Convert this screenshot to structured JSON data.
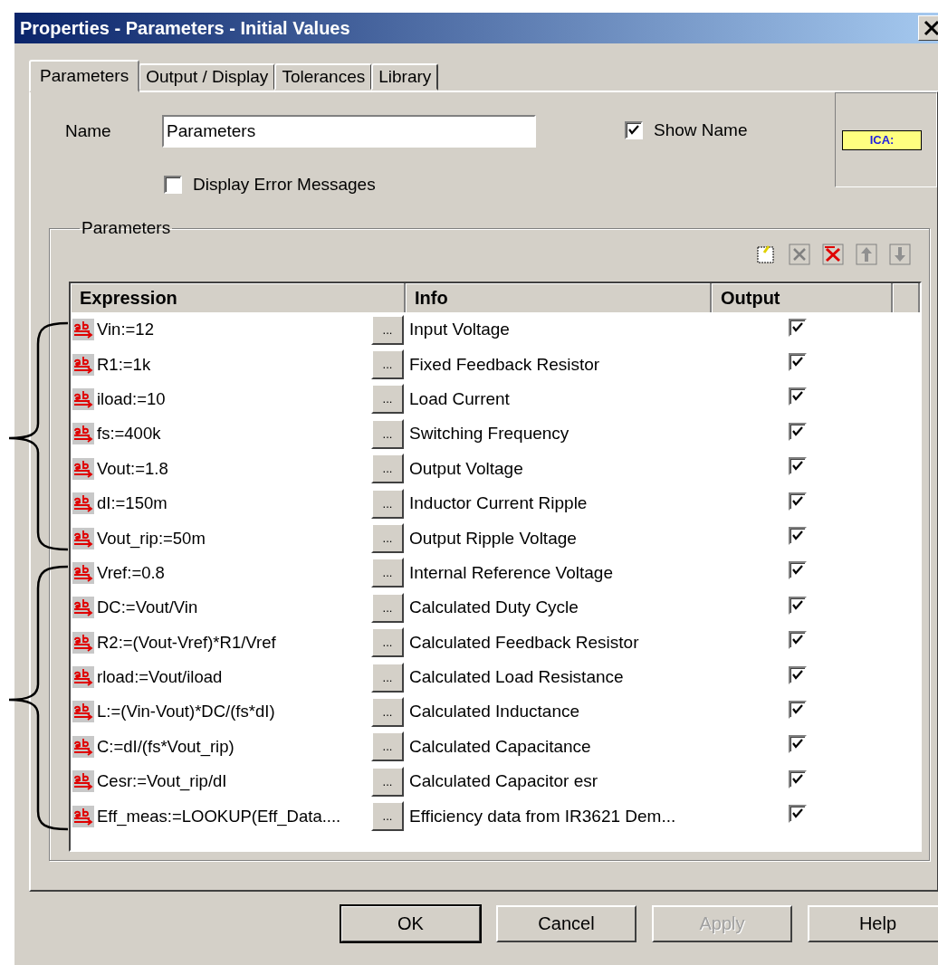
{
  "window": {
    "title": "Properties - Parameters - Initial Values"
  },
  "tabs": [
    {
      "label": "Parameters",
      "selected": true
    },
    {
      "label": "Output / Display",
      "selected": false
    },
    {
      "label": "Tolerances",
      "selected": false
    },
    {
      "label": "Library",
      "selected": false
    }
  ],
  "name_field": {
    "label": "Name",
    "value": "Parameters"
  },
  "show_name": {
    "label": "Show Name",
    "checked": true
  },
  "display_errors": {
    "label": "Display Error Messages",
    "checked": false
  },
  "preview": {
    "label": "ICA:"
  },
  "group": {
    "title": "Parameters"
  },
  "table": {
    "columns": [
      "Expression",
      "Info",
      "Output"
    ],
    "rows": [
      {
        "expression": "Vin:=12",
        "button": "...",
        "info": "Input Voltage",
        "output": true
      },
      {
        "expression": "R1:=1k",
        "button": "...",
        "info": "Fixed Feedback Resistor",
        "output": true
      },
      {
        "expression": "iload:=10",
        "button": "...",
        "info": "Load Current",
        "output": true
      },
      {
        "expression": "fs:=400k",
        "button": "...",
        "info": "Switching Frequency",
        "output": true
      },
      {
        "expression": "Vout:=1.8",
        "button": "...",
        "info": "Output Voltage",
        "output": true
      },
      {
        "expression": "dI:=150m",
        "button": "...",
        "info": "Inductor Current Ripple",
        "output": true
      },
      {
        "expression": "Vout_rip:=50m",
        "button": "...",
        "info": "Output Ripple Voltage",
        "output": true
      },
      {
        "expression": "Vref:=0.8",
        "button": "...",
        "info": "Internal Reference Voltage",
        "output": true
      },
      {
        "expression": "DC:=Vout/Vin",
        "button": "...",
        "info": "Calculated Duty Cycle",
        "output": true
      },
      {
        "expression": "R2:=(Vout-Vref)*R1/Vref",
        "button": "...",
        "info": "Calculated Feedback Resistor",
        "output": true
      },
      {
        "expression": "rload:=Vout/iload",
        "button": "...",
        "info": "Calculated Load Resistance",
        "output": true
      },
      {
        "expression": "L:=(Vin-Vout)*DC/(fs*dI)",
        "button": "...",
        "info": "Calculated Inductance",
        "output": true
      },
      {
        "expression": "C:=dI/(fs*Vout_rip)",
        "button": "...",
        "info": "Calculated Capacitance",
        "output": true
      },
      {
        "expression": "Cesr:=Vout_rip/dI",
        "button": "...",
        "info": "Calculated Capacitor esr",
        "output": true
      },
      {
        "expression": "Eff_meas:=LOOKUP(Eff_Data....",
        "button": "...",
        "info": "Efficiency data from IR3621 Dem...",
        "output": true
      }
    ]
  },
  "buttons": [
    {
      "label": "OK",
      "default": true,
      "disabled": false
    },
    {
      "label": "Cancel",
      "default": false,
      "disabled": false
    },
    {
      "label": "Apply",
      "default": false,
      "disabled": true
    },
    {
      "label": "Help",
      "default": false,
      "disabled": false
    }
  ]
}
